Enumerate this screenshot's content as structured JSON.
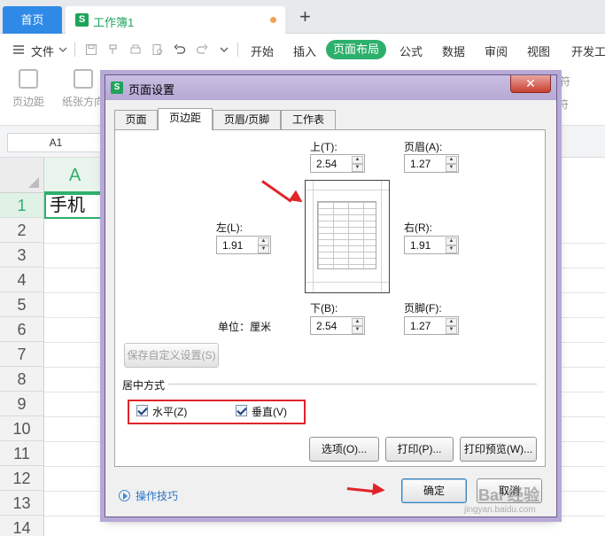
{
  "app": {
    "home_tab": "首页",
    "doc_tab": "工作簿1",
    "logo_letter": "S",
    "new_tab_symbol": "+"
  },
  "menu": {
    "file": "文件",
    "items": [
      "开始",
      "插入",
      "页面布局",
      "公式",
      "数据",
      "审阅",
      "视图",
      "开发工"
    ],
    "active": "页面布局"
  },
  "ribbon": {
    "margins": "页边距",
    "orientation": "纸张方向",
    "right_fragment_top": "符",
    "right_fragment_bottom": "符"
  },
  "formula_bar": {
    "name_box": "A1"
  },
  "sheet": {
    "column_a": "A",
    "rows": [
      "1",
      "2",
      "3",
      "4",
      "5",
      "6",
      "7",
      "8",
      "9",
      "10",
      "11",
      "12",
      "13",
      "14"
    ],
    "cell_a1": "手机"
  },
  "dialog": {
    "title": "页面设置",
    "close_symbol": "✕",
    "tabs": [
      "页面",
      "页边距",
      "页眉/页脚",
      "工作表"
    ],
    "active_tab": "页边距",
    "margins": {
      "top_label": "上(T):",
      "top_value": "2.54",
      "header_label": "页眉(A):",
      "header_value": "1.27",
      "left_label": "左(L):",
      "left_value": "1.91",
      "right_label": "右(R):",
      "right_value": "1.91",
      "bottom_label": "下(B):",
      "bottom_value": "2.54",
      "footer_label": "页脚(F):",
      "footer_value": "1.27",
      "unit_label": "单位：厘米"
    },
    "save_custom": "保存自定义设置(S)",
    "center_group": "居中方式",
    "horizontal": "水平(Z)",
    "vertical": "垂直(V)",
    "horizontal_checked": true,
    "vertical_checked": true,
    "options_button": "选项(O)...",
    "print_button": "打印(P)...",
    "preview_button": "打印预览(W)...",
    "ok_button": "确定",
    "cancel_button": "取消",
    "tips_link": "操作技巧"
  },
  "watermark": {
    "text": "Bai 经验",
    "url": "jingyan.baidu.com"
  },
  "colors": {
    "accent_green": "#2db06c",
    "annotation_red": "#e0242a",
    "dialog_frame": "#b7a9d6"
  }
}
